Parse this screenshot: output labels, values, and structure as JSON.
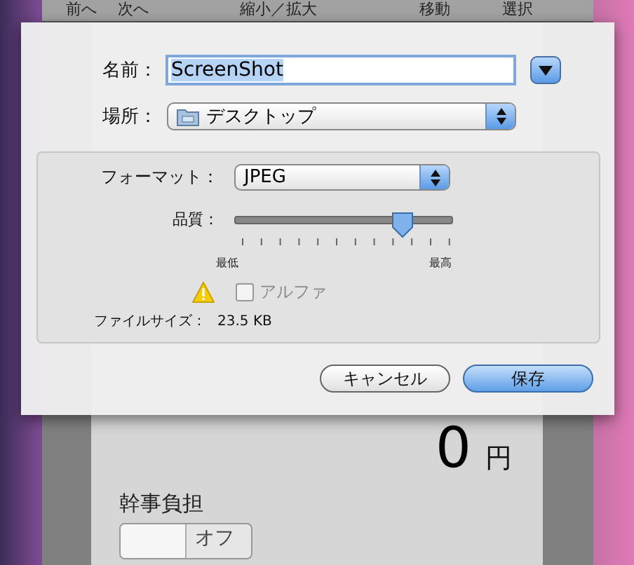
{
  "background_window": {
    "toolbar": [
      "前へ",
      "次へ",
      "縮小／拡大",
      "移動",
      "選択"
    ],
    "total": {
      "amount": "0",
      "unit": "円"
    },
    "organizer_share": {
      "label": "幹事負担",
      "toggle": {
        "label": "オフ",
        "on": false
      }
    }
  },
  "dialog": {
    "name": {
      "label": "名前：",
      "value": "ScreenShot",
      "highlighted": true
    },
    "location": {
      "label": "場所：",
      "value": "デスクトップ"
    },
    "options": {
      "format": {
        "label": "フォーマット：",
        "value": "JPEG"
      },
      "quality": {
        "label": "品質：",
        "level": 0.77,
        "min_label": "最低",
        "max_label": "最高"
      },
      "alpha": {
        "label": "アルファ",
        "checked": false,
        "disabled": true
      },
      "file_size": {
        "label": "ファイルサイズ：",
        "value": "23.5 KB"
      }
    },
    "buttons": [
      {
        "label": "キャンセル",
        "default": false
      },
      {
        "label": "保存",
        "default": true
      }
    ]
  }
}
